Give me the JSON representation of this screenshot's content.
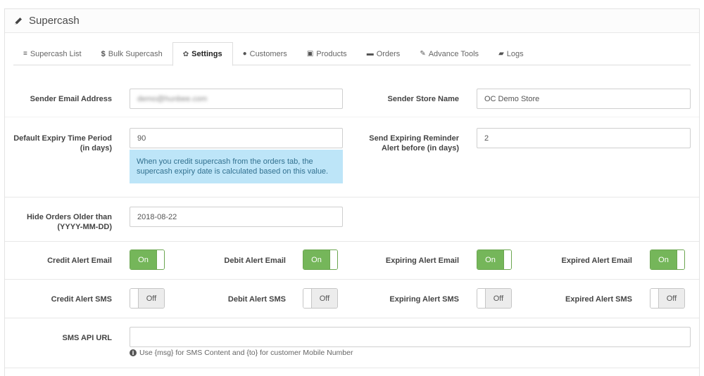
{
  "header": {
    "title": "Supercash",
    "icon": "pencil-icon"
  },
  "tabs": [
    {
      "label": "Supercash List",
      "icon": "list-icon",
      "glyph": "≡"
    },
    {
      "label": "Bulk Supercash",
      "icon": "dollar-icon",
      "glyph": "$"
    },
    {
      "label": "Settings",
      "icon": "gear-icon",
      "glyph": "✿",
      "active": true
    },
    {
      "label": "Customers",
      "icon": "user-icon",
      "glyph": "●"
    },
    {
      "label": "Products",
      "icon": "gift-icon",
      "glyph": "▣"
    },
    {
      "label": "Orders",
      "icon": "cart-icon",
      "glyph": "▬"
    },
    {
      "label": "Advance Tools",
      "icon": "wrench-icon",
      "glyph": "✎"
    },
    {
      "label": "Logs",
      "icon": "book-icon",
      "glyph": "▰"
    }
  ],
  "form": {
    "sender_email": {
      "label": "Sender Email Address",
      "value": "demo@hunbee.com"
    },
    "sender_store": {
      "label": "Sender Store Name",
      "value": "OC Demo Store"
    },
    "expiry_period": {
      "label_line1": "Default Expiry Time Period",
      "label_line2": "(in days)",
      "value": "90",
      "help_line1": "When you credit supercash from the orders tab, the",
      "help_line2": "supercash expiry date is calculated based on this value."
    },
    "reminder": {
      "label_line1": "Send Expiring Reminder",
      "label_line2": "Alert before (in days)",
      "value": "2"
    },
    "hide_orders": {
      "label_line1": "Hide Orders Older than",
      "label_line2": "(YYYY-MM-DD)",
      "value": "2018-08-22"
    },
    "email_toggles": [
      {
        "label": "Credit Alert Email",
        "state": "On"
      },
      {
        "label": "Debit Alert Email",
        "state": "On"
      },
      {
        "label": "Expiring Alert Email",
        "state": "On"
      },
      {
        "label": "Expired Alert Email",
        "state": "On"
      }
    ],
    "sms_toggles": [
      {
        "label": "Credit Alert SMS",
        "state": "Off"
      },
      {
        "label": "Debit Alert SMS",
        "state": "Off"
      },
      {
        "label": "Expiring Alert SMS",
        "state": "Off"
      },
      {
        "label": "Expired Alert SMS",
        "state": "Off"
      }
    ],
    "sms_api": {
      "label": "SMS API URL",
      "value": "",
      "hint": "Use {msg} for SMS Content and {to} for customer Mobile Number"
    }
  },
  "colors": {
    "toggle_on": "#75b65a",
    "help_bg": "#bde5f8",
    "help_text": "#31708f"
  }
}
